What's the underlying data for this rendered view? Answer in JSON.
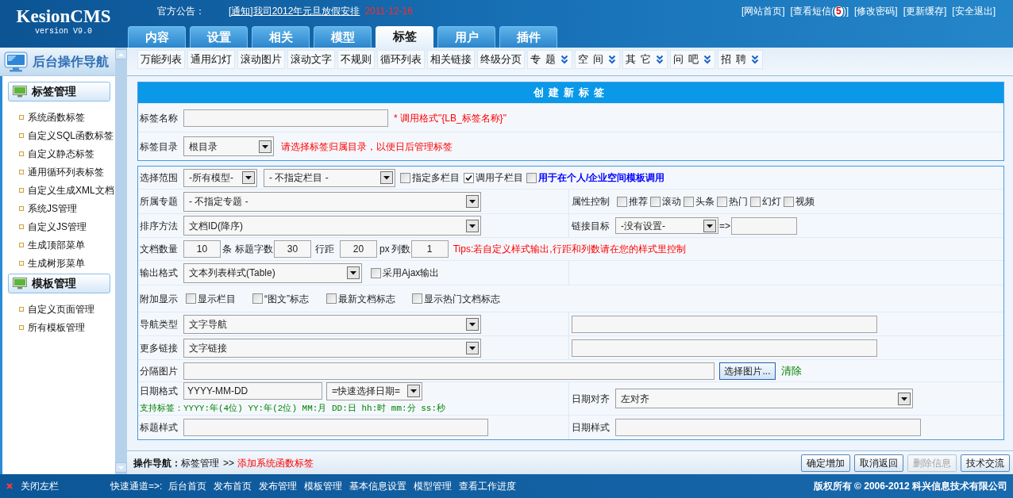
{
  "header": {
    "logo": "KesionCMS",
    "version": "version V9.0",
    "notice_label": "官方公告：",
    "notice_link": "[通知]我司2012年元旦放假安排",
    "notice_date": "2011-12-16",
    "links": [
      {
        "text": "[网站首页]"
      },
      {
        "text": "[查看短信(",
        "count": "5",
        "after": ")]"
      },
      {
        "text": "[修改密码]"
      },
      {
        "text": "[更新缓存]"
      },
      {
        "text": "[安全退出]"
      }
    ]
  },
  "tabs": [
    {
      "label": "内容",
      "selected": false
    },
    {
      "label": "设置",
      "selected": false
    },
    {
      "label": "相关",
      "selected": false
    },
    {
      "label": "模型",
      "selected": false
    },
    {
      "label": "标签",
      "selected": true
    },
    {
      "label": "用户",
      "selected": false
    },
    {
      "label": "插件",
      "selected": false
    }
  ],
  "sidebar": {
    "title": "后台操作导航",
    "groups": [
      {
        "title": "标签管理",
        "items": [
          "系统函数标签",
          "自定义SQL函数标签",
          "自定义静态标签",
          "通用循环列表标签",
          "自定义生成XML文档",
          "系统JS管理",
          "自定义JS管理",
          "生成顶部菜单",
          "生成树形菜单"
        ]
      },
      {
        "title": "模板管理",
        "items": [
          "自定义页面管理",
          "所有模板管理"
        ]
      }
    ]
  },
  "toolbar": [
    {
      "kind": "button",
      "label": "万能列表"
    },
    {
      "kind": "button",
      "label": "通用幻灯"
    },
    {
      "kind": "button",
      "label": "滚动图片"
    },
    {
      "kind": "button",
      "label": "滚动文字"
    },
    {
      "kind": "button",
      "label": "不规则"
    },
    {
      "kind": "button",
      "label": "循环列表"
    },
    {
      "kind": "button",
      "label": "相关链接"
    },
    {
      "kind": "button",
      "label": "终级分页"
    },
    {
      "kind": "menu",
      "label": "专 题"
    },
    {
      "kind": "menu",
      "label": "空 间"
    },
    {
      "kind": "menu",
      "label": "其 它"
    },
    {
      "kind": "menu",
      "label": "问 吧"
    },
    {
      "kind": "menu",
      "label": "招 聘"
    }
  ],
  "create_panel": {
    "title": "创建新标签",
    "rows": [
      {
        "label": "标签名称",
        "fields": [
          {
            "kind": "input"
          },
          {
            "kind": "note",
            "text": "* 调用格式\"{LB_标签名称}\""
          }
        ]
      },
      {
        "label": "标签目录",
        "fields": [
          {
            "kind": "select",
            "value": "根目录"
          },
          {
            "kind": "note",
            "text": "请选择标签归属目录，以便日后管理标签"
          }
        ]
      }
    ]
  },
  "options_panel": {
    "rows": [
      {
        "kind": "full",
        "label": "选择范围",
        "fields": [
          {
            "kind": "select",
            "value": "-所有模型-"
          },
          {
            "kind": "select",
            "value": "- 不指定栏目 -"
          },
          {
            "kind": "checkbox",
            "label": "指定多栏目",
            "checked": false
          },
          {
            "kind": "checkbox",
            "label": "调用子栏目",
            "checked": true
          },
          {
            "kind": "checkbox",
            "label": "用于在个人/企业空间模板调用",
            "checked": false,
            "emphasis": true
          }
        ]
      },
      {
        "kind": "split",
        "label": "所属专题",
        "fields": [
          {
            "kind": "select",
            "value": "- 不指定专题 -"
          }
        ],
        "right": {
          "label": "属性控制",
          "fields": [
            {
              "kind": "checkbox",
              "label": "推荐",
              "checked": false
            },
            {
              "kind": "checkbox",
              "label": "滚动",
              "checked": false
            },
            {
              "kind": "checkbox",
              "label": "头条",
              "checked": false
            },
            {
              "kind": "checkbox",
              "label": "热门",
              "checked": false
            },
            {
              "kind": "checkbox",
              "label": "幻灯",
              "checked": false
            },
            {
              "kind": "checkbox",
              "label": "视频",
              "checked": false
            }
          ]
        }
      },
      {
        "kind": "split",
        "label": "排序方法",
        "fields": [
          {
            "kind": "select",
            "value": "文档ID(降序)"
          }
        ],
        "right": {
          "label": "链接目标",
          "fields": [
            {
              "kind": "select",
              "value": "-没有设置-"
            },
            {
              "kind": "text",
              "text": "=>"
            },
            {
              "kind": "input"
            }
          ]
        }
      },
      {
        "kind": "full",
        "label": "文档数量",
        "fields": [
          {
            "kind": "input",
            "value": "10"
          },
          {
            "kind": "text",
            "text": "条"
          },
          {
            "kind": "text",
            "text": "标题字数"
          },
          {
            "kind": "input",
            "value": "30"
          },
          {
            "kind": "text",
            "text": "行距"
          },
          {
            "kind": "input",
            "value": "20"
          },
          {
            "kind": "text",
            "text": "px"
          },
          {
            "kind": "text",
            "text": "列数"
          },
          {
            "kind": "input",
            "value": "1"
          },
          {
            "kind": "note",
            "text": "Tips:若自定义样式输出,行距和列数请在您的样式里控制"
          }
        ]
      },
      {
        "kind": "split",
        "label": "输出格式",
        "fields": [
          {
            "kind": "select",
            "value": "文本列表样式(Table)"
          },
          {
            "kind": "checkbox",
            "label": "采用Ajax输出",
            "checked": false
          }
        ]
      },
      {
        "kind": "full",
        "label": "附加显示",
        "fields": [
          {
            "kind": "checkbox",
            "label": "显示栏目",
            "checked": false
          },
          {
            "kind": "checkbox",
            "label": "“图文”标志",
            "checked": false
          },
          {
            "kind": "checkbox",
            "label": "最新文档标志",
            "checked": false
          },
          {
            "kind": "checkbox",
            "label": "显示热门文档标志",
            "checked": false
          }
        ]
      },
      {
        "kind": "split",
        "label": "导航类型",
        "fields": [
          {
            "kind": "select",
            "value": "文字导航"
          }
        ],
        "right": {
          "fields": [
            {
              "kind": "input"
            }
          ]
        }
      },
      {
        "kind": "split",
        "label": "更多链接",
        "fields": [
          {
            "kind": "select",
            "value": "文字链接"
          }
        ],
        "right": {
          "fields": [
            {
              "kind": "input"
            }
          ]
        }
      },
      {
        "kind": "full",
        "label": "分隔图片",
        "fields": [
          {
            "kind": "input"
          },
          {
            "kind": "button",
            "label": "选择图片..."
          },
          {
            "kind": "link",
            "text": "清除"
          }
        ]
      },
      {
        "kind": "split",
        "label": "日期格式",
        "fields": [
          {
            "kind": "input",
            "value": "YYYY-MM-DD"
          },
          {
            "kind": "select",
            "value": "=快速选择日期="
          },
          {
            "kind": "hint",
            "text": "支持标签：YYYY:年(4位) YY:年(2位) MM:月 DD:日 hh:时 mm:分 ss:秒"
          }
        ],
        "right": {
          "label": "日期对齐",
          "fields": [
            {
              "kind": "select",
              "value": "左对齐"
            }
          ]
        }
      },
      {
        "kind": "split",
        "label": "标题样式",
        "fields": [
          {
            "kind": "input"
          }
        ],
        "right": {
          "label": "日期样式",
          "fields": [
            {
              "kind": "input"
            }
          ]
        }
      }
    ]
  },
  "breadcrumb": {
    "label": "操作导航：",
    "path": "标签管理",
    "separator": ">>",
    "current": "添加系统函数标签"
  },
  "actions": [
    {
      "label": "确定增加",
      "disabled": false
    },
    {
      "label": "取消返回",
      "disabled": false
    },
    {
      "label": "删除信息",
      "disabled": true
    },
    {
      "label": "技术交流",
      "disabled": false
    }
  ],
  "footer": {
    "close": "关闭左栏",
    "quick_label": "快速通道=>:",
    "links": [
      "后台首页",
      "发布首页",
      "发布管理",
      "模板管理",
      "基本信息设置",
      "模型管理",
      "查看工作进度"
    ],
    "copyright": "版权所有 © 2006-2012 科兴信息技术有限公司"
  }
}
